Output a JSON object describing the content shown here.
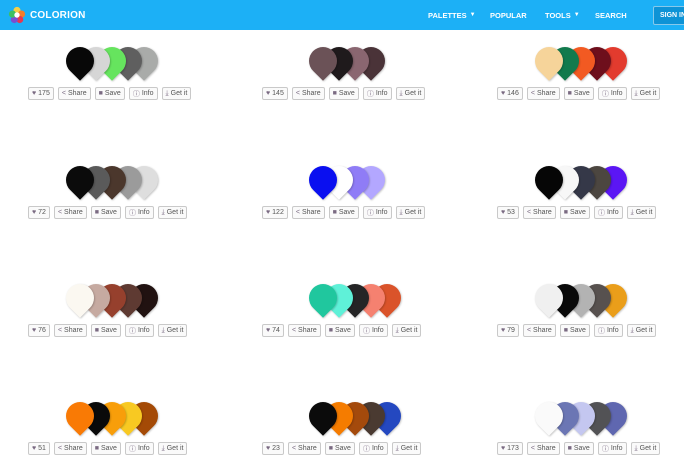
{
  "brand": {
    "name": "COLORION"
  },
  "nav": {
    "palettes": "PALETTES",
    "popular": "POPULAR",
    "tools": "TOOLS",
    "search": "SEARCH",
    "signin": "SIGN IN"
  },
  "actions": {
    "share": "Share",
    "save": "Save",
    "info": "Info",
    "get": "Get it"
  },
  "palettes": [
    {
      "likes": "175",
      "colors": [
        "#080808",
        "#d6d6d6",
        "#66e45e",
        "#5f5f5f",
        "#a9aba9"
      ]
    },
    {
      "likes": "145",
      "colors": [
        "#6b5257",
        "#1f1a1c",
        "#8a6670",
        "#4a3338"
      ]
    },
    {
      "likes": "146",
      "colors": [
        "#f6d49a",
        "#127a4d",
        "#f25a22",
        "#6e0f1c",
        "#e23b2e"
      ]
    },
    {
      "likes": "72",
      "colors": [
        "#0b0b0b",
        "#5a5a5a",
        "#4b372c",
        "#9b9b9b",
        "#dedede"
      ]
    },
    {
      "likes": "122",
      "colors": [
        "#0a0ff0",
        "#ffffff",
        "#8f7cf6",
        "#b3a7ff"
      ]
    },
    {
      "likes": "53",
      "colors": [
        "#060606",
        "#f7f7f7",
        "#353848",
        "#4c4640",
        "#5b16f4"
      ]
    },
    {
      "likes": "76",
      "colors": [
        "#fbf8f1",
        "#c6aaa1",
        "#96402d",
        "#5e3a32",
        "#211211"
      ]
    },
    {
      "likes": "74",
      "colors": [
        "#20c79e",
        "#5ff1d8",
        "#252526",
        "#f58170",
        "#da532a"
      ]
    },
    {
      "likes": "79",
      "colors": [
        "#f0f0f0",
        "#0a0a0a",
        "#b3b3b3",
        "#57514f",
        "#ea9e1a"
      ]
    },
    {
      "likes": "51",
      "colors": [
        "#f97a05",
        "#0a0a0a",
        "#f89e0a",
        "#f8c922",
        "#a44a06"
      ]
    },
    {
      "likes": "23",
      "colors": [
        "#0b0b0b",
        "#f57c00",
        "#a44a0c",
        "#4a3a31",
        "#2448c0"
      ]
    },
    {
      "likes": "173",
      "colors": [
        "#fafafa",
        "#6b76b4",
        "#c4c7f0",
        "#525255",
        "#5f67b0"
      ]
    }
  ]
}
